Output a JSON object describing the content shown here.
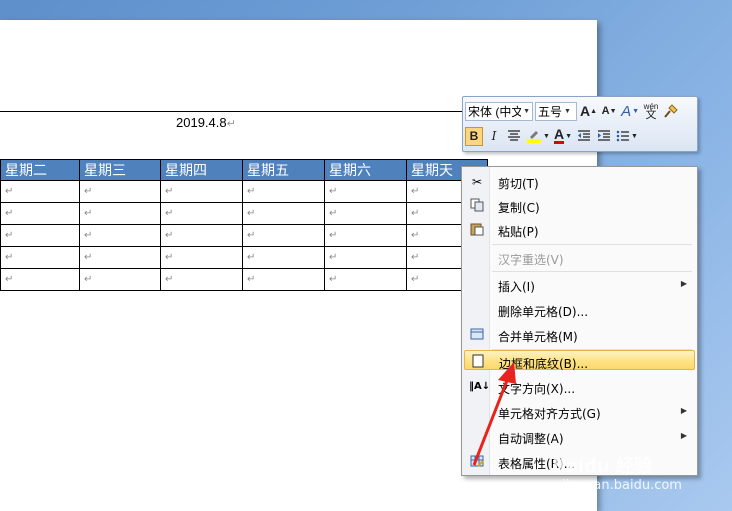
{
  "document": {
    "date": "2019.4.8",
    "para_mark": "↵",
    "table_headers": [
      "星期二",
      "星期三",
      "星期四",
      "星期五",
      "星期六",
      "星期天"
    ],
    "row_count": 5
  },
  "mini_toolbar": {
    "font_name": "宋体 (中文",
    "font_size": "五号",
    "grow_font": "A",
    "shrink_font": "A",
    "style_icon": "A",
    "phonetic": "wén",
    "bold": "B",
    "italic": "I",
    "font_color": "A"
  },
  "context_menu": {
    "items": [
      {
        "label": "剪切(T)",
        "icon": "scissors-icon"
      },
      {
        "label": "复制(C)",
        "icon": "copy-icon"
      },
      {
        "label": "粘贴(P)",
        "icon": "paste-icon"
      },
      {
        "label": "汉字重选(V)",
        "disabled": true
      },
      {
        "label": "插入(I)",
        "submenu": true
      },
      {
        "label": "删除单元格(D)..."
      },
      {
        "label": "合并单元格(M)",
        "icon": "merge-cells-icon"
      },
      {
        "label": "边框和底纹(B)...",
        "icon": "borders-icon",
        "highlighted": true
      },
      {
        "label": "文字方向(X)...",
        "icon": "text-direction-icon"
      },
      {
        "label": "单元格对齐方式(G)",
        "submenu": true
      },
      {
        "label": "自动调整(A)",
        "submenu": true
      },
      {
        "label": "表格属性(R)...",
        "icon": "table-properties-icon"
      }
    ]
  },
  "watermark": {
    "brand": "Baidu 经验",
    "url": "jingyan.baidu.com"
  },
  "colors": {
    "header_fill": "#4f81bd",
    "highlight": "#fde38a",
    "arrow": "#e8231c"
  }
}
